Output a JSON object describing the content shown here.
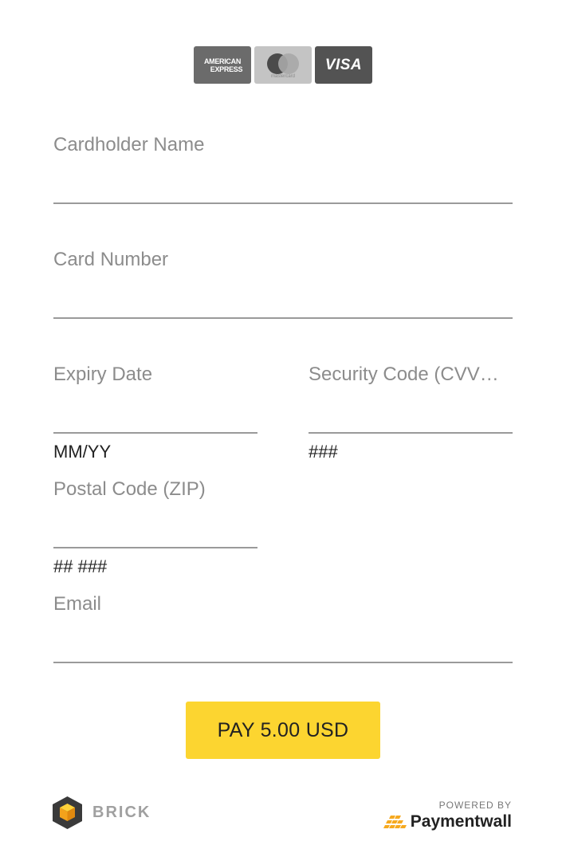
{
  "card_logos": {
    "amex_line1": "AMERICAN",
    "amex_line2": "EXPRESS",
    "mastercard_text": "mastercard",
    "visa_text": "VISA"
  },
  "form": {
    "cardholder_name": {
      "label": "Cardholder Name",
      "value": ""
    },
    "card_number": {
      "label": "Card Number",
      "value": ""
    },
    "expiry_date": {
      "label": "Expiry Date",
      "value": "",
      "hint": "MM/YY"
    },
    "security_code": {
      "label": "Security Code (CVV…",
      "value": "",
      "hint": "###"
    },
    "postal_code": {
      "label": "Postal Code (ZIP)",
      "value": "",
      "hint": "## ###"
    },
    "email": {
      "label": "Email",
      "value": ""
    }
  },
  "pay_button": {
    "label": "PAY 5.00 USD",
    "color": "#fcd530"
  },
  "footer": {
    "brick_label": "BRICK",
    "brick_icon": "brick-cube-icon",
    "powered_by": "POWERED BY",
    "paymentwall_label": "Paymentwall",
    "paymentwall_icon": "paymentwall-bricks-icon"
  }
}
